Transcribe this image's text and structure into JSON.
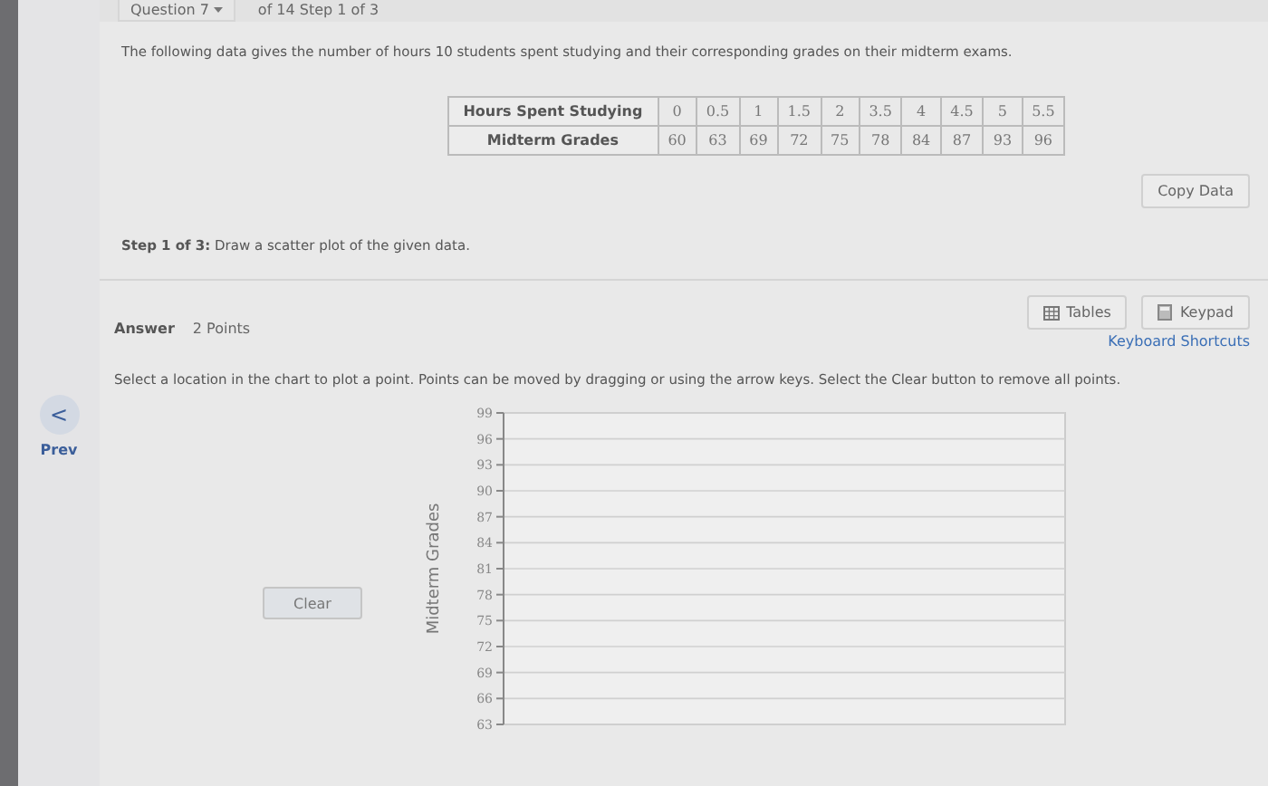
{
  "header": {
    "question_menu": "Question 7",
    "progress": "of 14 Step 1 of 3"
  },
  "intro": "The following data gives the number of hours 10 students spent studying and their corresponding grades on their midterm exams.",
  "table": {
    "rows": [
      {
        "header": "Hours Spent Studying",
        "cells": [
          "0",
          "0.5",
          "1",
          "1.5",
          "2",
          "3.5",
          "4",
          "4.5",
          "5",
          "5.5"
        ]
      },
      {
        "header": "Midterm Grades",
        "cells": [
          "60",
          "63",
          "69",
          "72",
          "75",
          "78",
          "84",
          "87",
          "93",
          "96"
        ]
      }
    ]
  },
  "copy_button": "Copy Data",
  "step": {
    "label": "Step 1 of 3:",
    "text": "Draw a scatter plot of the given data."
  },
  "answer": {
    "label": "Answer",
    "points": "2 Points"
  },
  "tools": [
    {
      "label": "Tables",
      "kind": "tables"
    },
    {
      "label": "Keypad",
      "kind": "keypad"
    }
  ],
  "shortcuts_link": "Keyboard Shortcuts",
  "prev": {
    "arrow": "<",
    "label": "Prev"
  },
  "instructions": "Select a location in the chart to plot a point. Points can be moved by dragging or using the arrow keys. Select the Clear button to remove all points.",
  "clear_button": "Clear",
  "plot_panel": {
    "y_axis_label": "Midterm Grades",
    "y_tick_labels": [
      "99",
      "96",
      "93",
      "90",
      "87",
      "84",
      "81",
      "78",
      "75",
      "72",
      "69",
      "66",
      "63"
    ]
  }
}
